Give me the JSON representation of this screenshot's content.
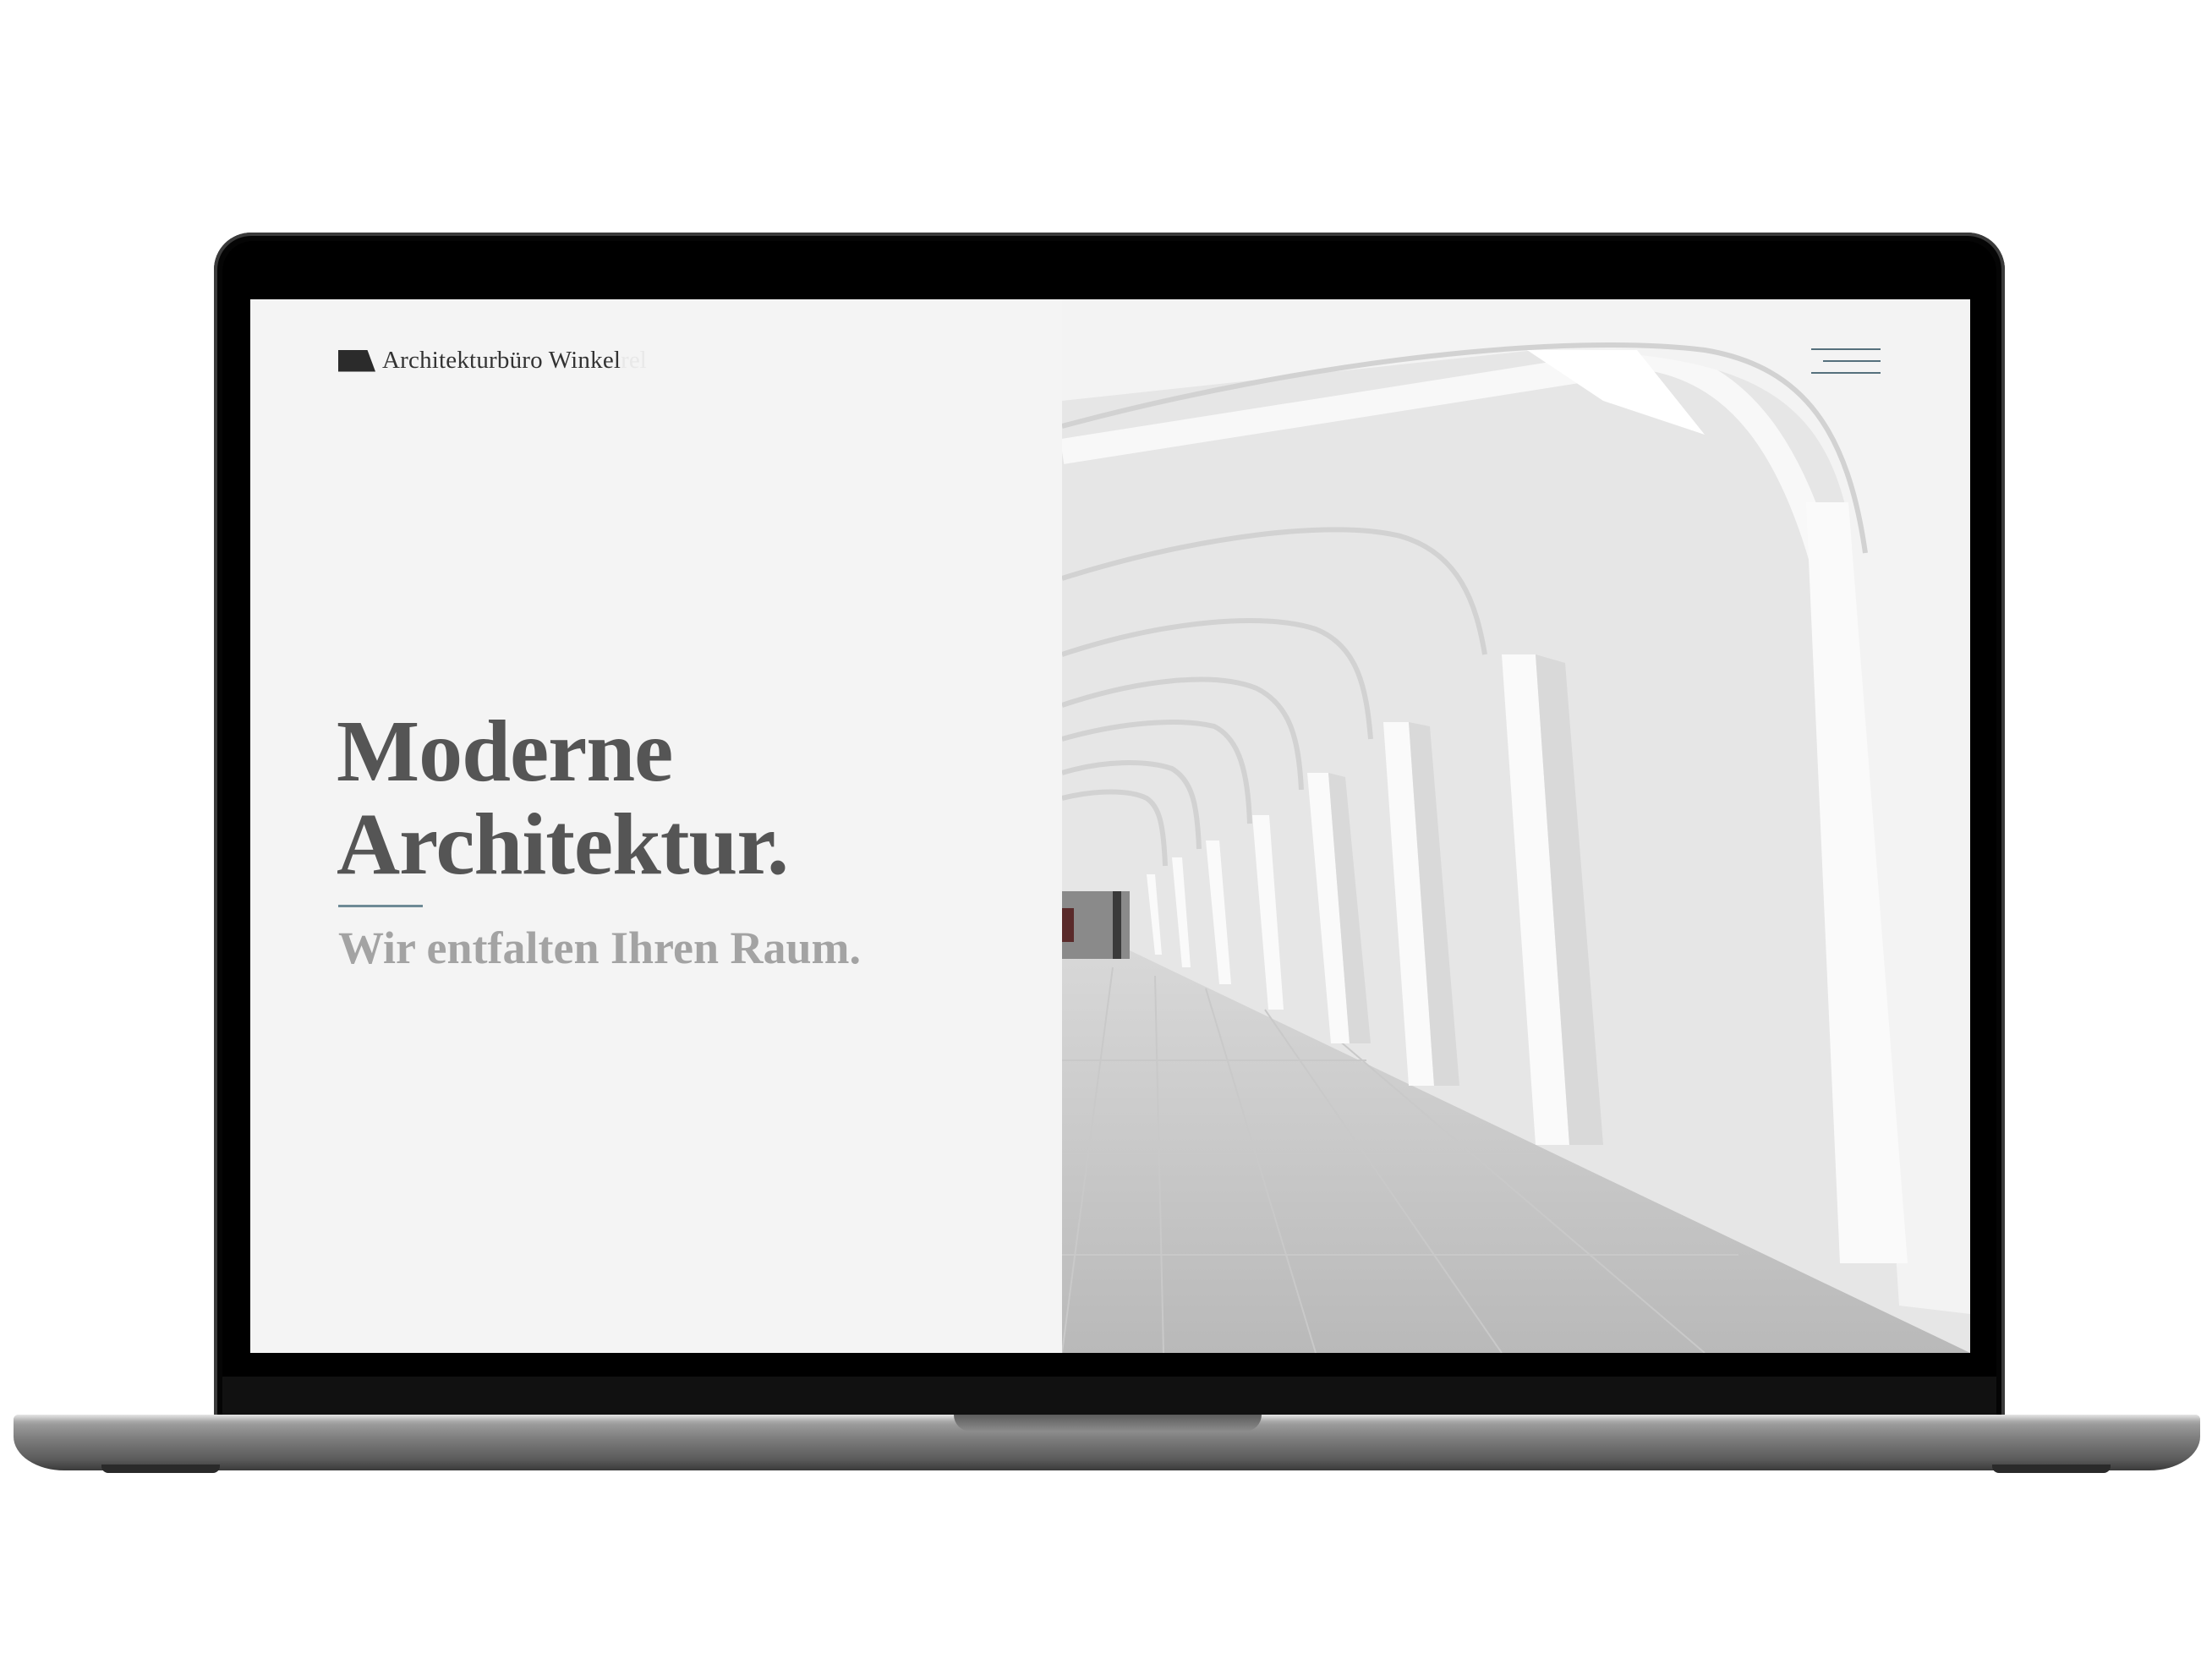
{
  "site": {
    "logo_text": "Architekturbüro Winkel",
    "logo_text_suffix": "rel"
  },
  "hero": {
    "headline_line1": "Moderne",
    "headline_line2": "Architektur.",
    "subline": "Wir entfalten Ihren Raum."
  },
  "colors": {
    "accent": "#6e8a96",
    "headline": "#555555",
    "subline": "#a3a3a3",
    "panel_bg": "#f4f4f4"
  },
  "icons": {
    "menu": "hamburger-menu-icon",
    "logo": "logo-mark-icon"
  },
  "device": "laptop"
}
